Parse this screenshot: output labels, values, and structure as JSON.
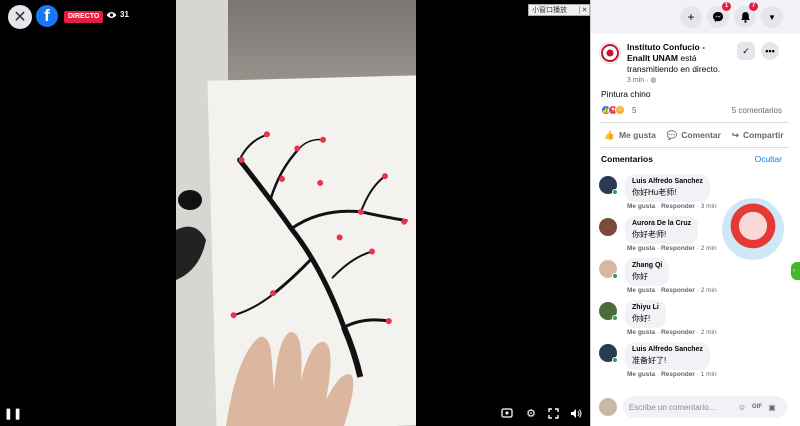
{
  "video": {
    "live_label": "DIRECTO",
    "viewer_count": "31",
    "pip_label": "小窗口播放",
    "pip_close": "✕"
  },
  "topbar": {
    "messenger_badge": "1",
    "notifications_badge": "7"
  },
  "post": {
    "page_name": "Instituto Confucio - Enallt UNAM",
    "status_text": " está transmitiendo en directo.",
    "time": "3 min · ",
    "text": "Pintura chino",
    "reaction_count": "5",
    "comment_count": "5 comentarios"
  },
  "actions": {
    "like": "Me gusta",
    "comment": "Comentar",
    "share": "Compartir"
  },
  "comments_section": {
    "title": "Comentarios",
    "hide": "Ocultar"
  },
  "comments": [
    {
      "name": "Luis Alfredo Sanchez",
      "text": "你好Hu老师!",
      "like": "Me gusta",
      "reply": "Responder",
      "time": "3 min",
      "avatar_color": "#2b3a55"
    },
    {
      "name": "Aurora De la Cruz",
      "text": "你好老师!",
      "like": "Me gusta",
      "reply": "Responder",
      "time": "2 min",
      "avatar_color": "#7a4a3a"
    },
    {
      "name": "Zhang Qi",
      "text": "你好",
      "like": "Me gusta",
      "reply": "Responder",
      "time": "2 min",
      "avatar_color": "#d9b8a0"
    },
    {
      "name": "Zhiyu Li",
      "text": "你好!",
      "like": "Me gusta",
      "reply": "Responder",
      "time": "2 min",
      "avatar_color": "#4d6b3a"
    },
    {
      "name": "Luis Alfredo Sanchez",
      "text": "准备好了!",
      "like": "Me gusta",
      "reply": "Responder",
      "time": "1 min",
      "avatar_color": "#2b3a55"
    }
  ],
  "comment_box": {
    "placeholder": "Escribe un comentario..."
  },
  "colors": {
    "facebook_blue": "#1877f2",
    "live_red": "#e41e3f"
  }
}
